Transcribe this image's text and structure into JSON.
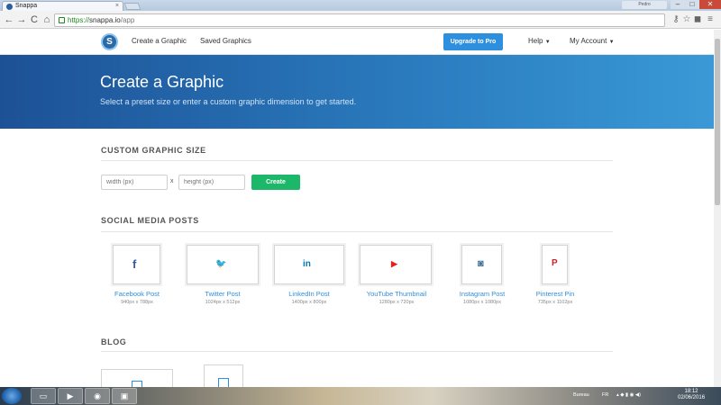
{
  "browser": {
    "tab_title": "Snappa",
    "tab_close": "×",
    "user_chip": "Pedro",
    "url_scheme": "https://",
    "url_host": "snappa.io",
    "url_path": "/app",
    "win_min": "–",
    "win_max": "□",
    "win_close": "✕",
    "back": "←",
    "forward": "→",
    "reload": "C",
    "home": "⌂"
  },
  "app": {
    "logo_letter": "S",
    "nav": {
      "create": "Create a Graphic",
      "saved": "Saved Graphics",
      "upgrade": "Upgrade to Pro",
      "help": "Help",
      "account": "My Account"
    }
  },
  "hero": {
    "title": "Create a Graphic",
    "subtitle": "Select a preset size or enter a custom graphic dimension to get started."
  },
  "custom": {
    "heading": "CUSTOM GRAPHIC SIZE",
    "width_placeholder": "width (px)",
    "height_placeholder": "height (px)",
    "times": "x",
    "create_label": "Create"
  },
  "social": {
    "heading": "SOCIAL MEDIA POSTS",
    "items": [
      {
        "name": "Facebook Post",
        "size": "940px x 788px",
        "glyph": "f",
        "color": "#3b5998"
      },
      {
        "name": "Twitter Post",
        "size": "1024px x 512px",
        "glyph": "🐦",
        "color": "#1da1f2"
      },
      {
        "name": "LinkedIn Post",
        "size": "1400px x 800px",
        "glyph": "in",
        "color": "#0077b5"
      },
      {
        "name": "YouTube Thumbnail",
        "size": "1280px x 720px",
        "glyph": "▶",
        "color": "#e62117"
      },
      {
        "name": "Instagram Post",
        "size": "1080px x 1080px",
        "glyph": "◙",
        "color": "#3f729b"
      },
      {
        "name": "Pinterest Pin",
        "size": "735px x 1102px",
        "glyph": "P",
        "color": "#cb2027"
      }
    ]
  },
  "blog": {
    "heading": "BLOG"
  },
  "taskbar": {
    "bureau": "Bureau",
    "lang": "FR",
    "time": "18:12",
    "date": "02/06/2016"
  }
}
